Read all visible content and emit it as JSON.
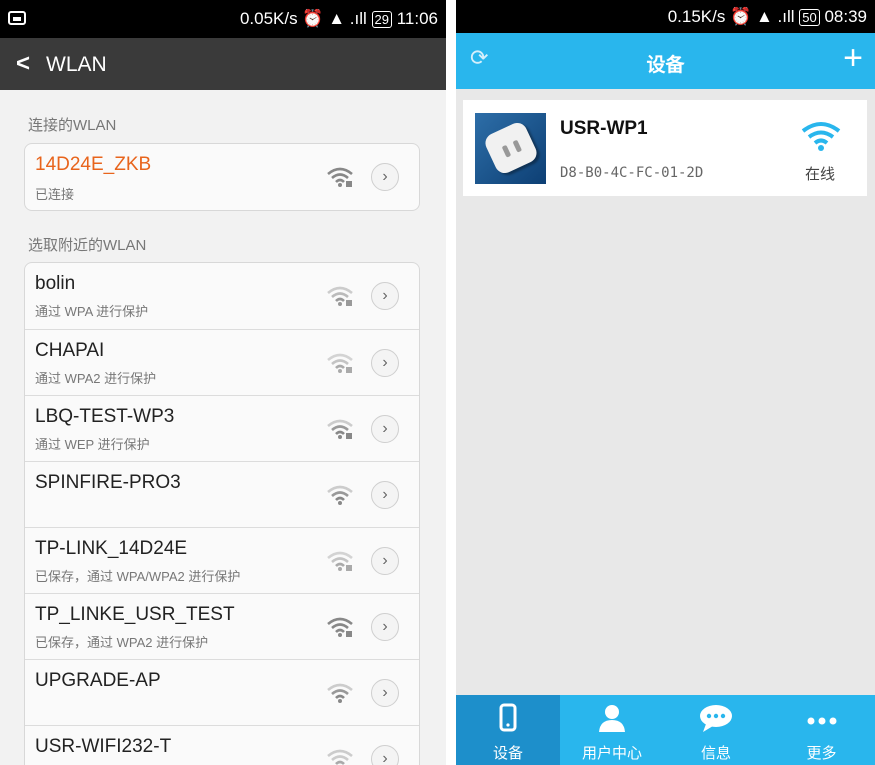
{
  "left": {
    "status": {
      "speed": "0.05K/s",
      "battery": "29",
      "time": "11:06"
    },
    "title": "WLAN",
    "connected_section": "连接的WLAN",
    "connected": {
      "ssid": "14D24E_ZKB",
      "status": "已连接"
    },
    "nearby_section": "选取附近的WLAN",
    "networks": [
      {
        "ssid": "bolin",
        "security": "通过 WPA 进行保护"
      },
      {
        "ssid": "CHAPAI",
        "security": "通过 WPA2 进行保护"
      },
      {
        "ssid": "LBQ-TEST-WP3",
        "security": "通过 WEP 进行保护"
      },
      {
        "ssid": "SPINFIRE-PRO3",
        "security": ""
      },
      {
        "ssid": "TP-LINK_14D24E",
        "security": "已保存，通过 WPA/WPA2 进行保护"
      },
      {
        "ssid": "TP_LINKE_USR_TEST",
        "security": "已保存，通过 WPA2 进行保护"
      },
      {
        "ssid": "UPGRADE-AP",
        "security": ""
      },
      {
        "ssid": "USR-WIFI232-T",
        "security": ""
      }
    ]
  },
  "right": {
    "status": {
      "speed": "0.15K/s",
      "battery": "50",
      "time": "08:39"
    },
    "header_title": "设备",
    "device": {
      "name": "USR-WP1",
      "mac": "D8-B0-4C-FC-01-2D",
      "status": "在线"
    },
    "tabs": [
      {
        "label": "设备",
        "icon": "phone-icon"
      },
      {
        "label": "用户中心",
        "icon": "user-icon"
      },
      {
        "label": "信息",
        "icon": "chat-icon"
      },
      {
        "label": "更多",
        "icon": "more-icon"
      }
    ],
    "colors": {
      "accent": "#29b6ed",
      "active_tab": "#1d8fcb",
      "connected_ssid": "#e8641c"
    }
  }
}
